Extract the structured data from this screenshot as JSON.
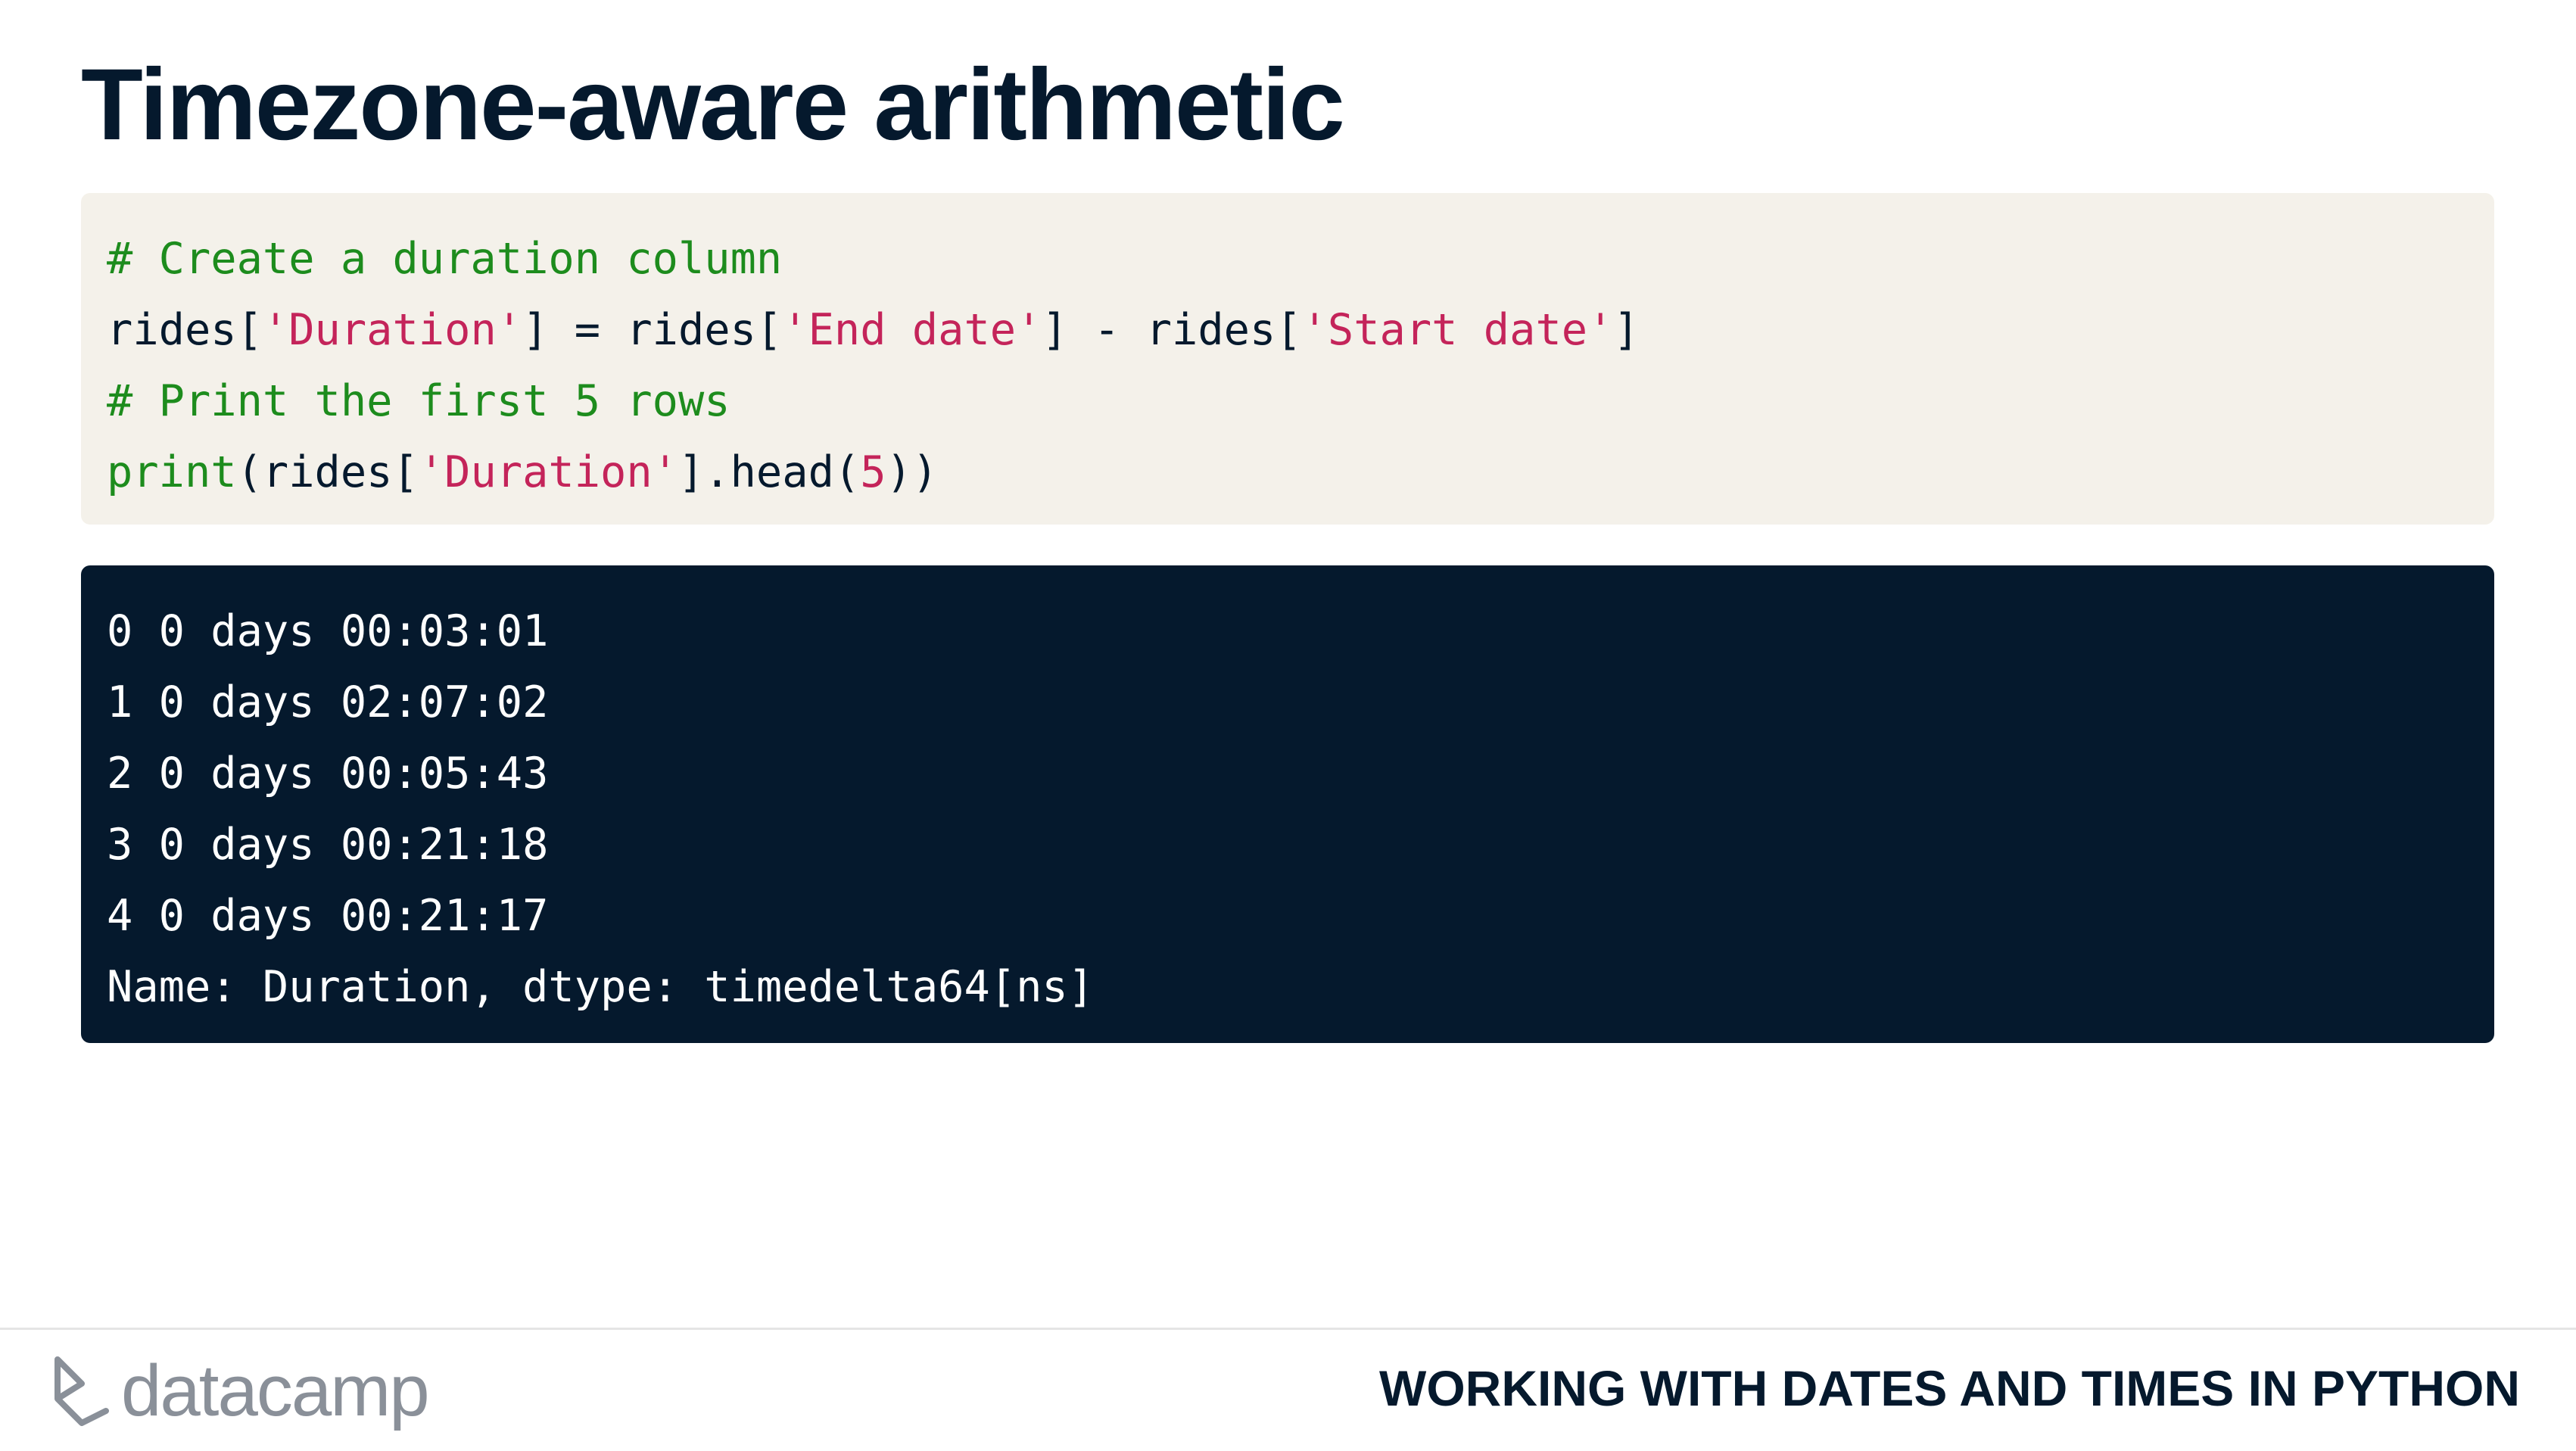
{
  "slide": {
    "title": "Timezone-aware arithmetic"
  },
  "code": {
    "comment1": "# Create a duration column",
    "line2": {
      "a": "rides[",
      "s1": "'Duration'",
      "b": "] = rides[",
      "s2": "'End date'",
      "c": "] - rides[",
      "s3": "'Start date'",
      "d": "]"
    },
    "comment2": "# Print the first 5 rows",
    "line4": {
      "fn": "print",
      "a": "(rides[",
      "s1": "'Duration'",
      "b": "].head(",
      "num": "5",
      "c": "))"
    }
  },
  "output": {
    "lines": [
      "0 0 days 00:03:01",
      "1 0 days 02:07:02",
      "2 0 days 00:05:43",
      "3 0 days 00:21:18",
      "4 0 days 00:21:17",
      "Name: Duration, dtype: timedelta64[ns]"
    ]
  },
  "footer": {
    "logo_text": "datacamp",
    "logo_icon": "datacamp-logo-icon",
    "course_name": "WORKING WITH DATES AND TIMES IN PYTHON"
  },
  "colors": {
    "navy": "#05192d",
    "code_bg": "#f4f1ea",
    "comment_green": "#1d8c1d",
    "string_pink": "#c4245a",
    "logo_gray": "#8a9099"
  }
}
